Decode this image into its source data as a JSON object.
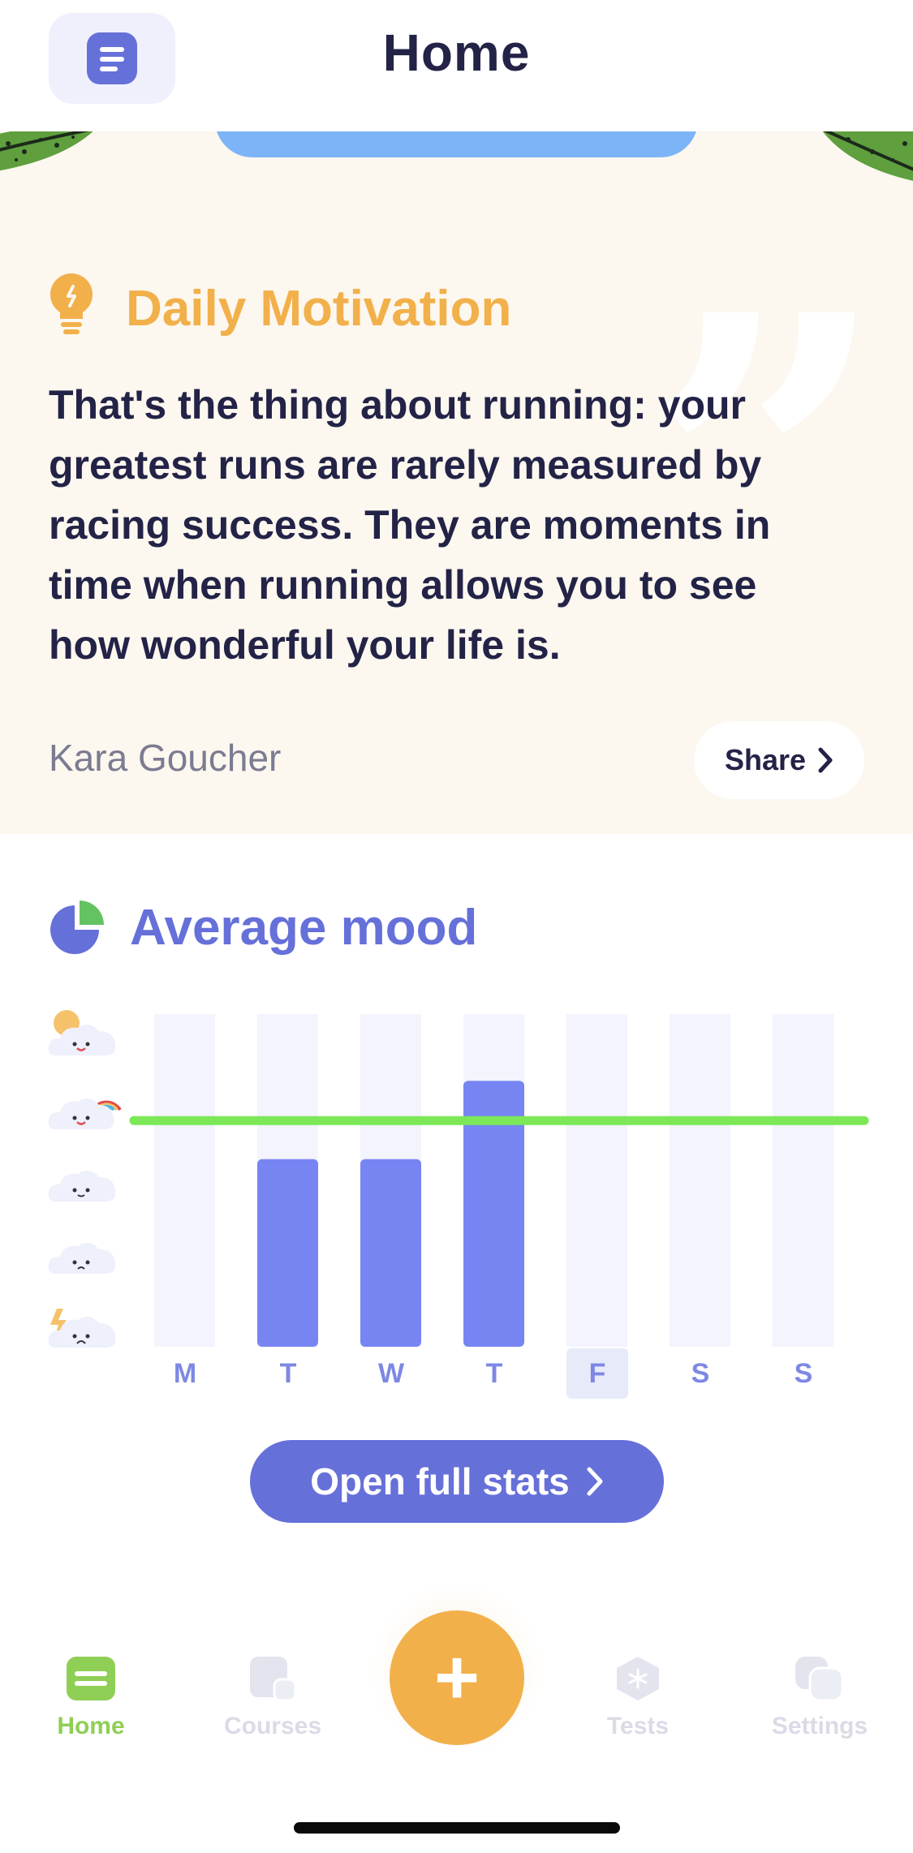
{
  "header": {
    "title": "Home"
  },
  "motivation": {
    "title": "Daily Motivation",
    "quote": "That's the thing about running: your greatest runs are rarely measured by racing success. They are moments in time when running allows you to see how wonderful your life is.",
    "author": "Kara Goucher",
    "share_label": "Share"
  },
  "mood": {
    "title": "Average mood",
    "scale": [
      "very-happy",
      "happy",
      "neutral",
      "sad",
      "very-sad"
    ],
    "chart_data": {
      "type": "bar",
      "categories": [
        "M",
        "T",
        "W",
        "T",
        "F",
        "S",
        "S"
      ],
      "values": [
        null,
        3,
        3,
        4,
        null,
        null,
        null
      ],
      "average": 3.7,
      "ylim": [
        1,
        5
      ],
      "highlighted_category_index": 4,
      "colors": {
        "bar": "#7785f2",
        "track": "#f3f4fd",
        "average_line": "#7ce858"
      }
    },
    "open_stats_label": "Open full stats"
  },
  "tabbar": {
    "items": [
      {
        "label": "Home",
        "icon": "home-icon",
        "active": true
      },
      {
        "label": "Courses",
        "icon": "courses-icon",
        "active": false
      },
      {
        "label": "Tests",
        "icon": "tests-icon",
        "active": false
      },
      {
        "label": "Settings",
        "icon": "settings-icon",
        "active": false
      }
    ],
    "add_label": "+"
  },
  "colors": {
    "accent": "#6670d9",
    "motivation": "#f2b04a",
    "active_tab": "#8fcf55"
  }
}
